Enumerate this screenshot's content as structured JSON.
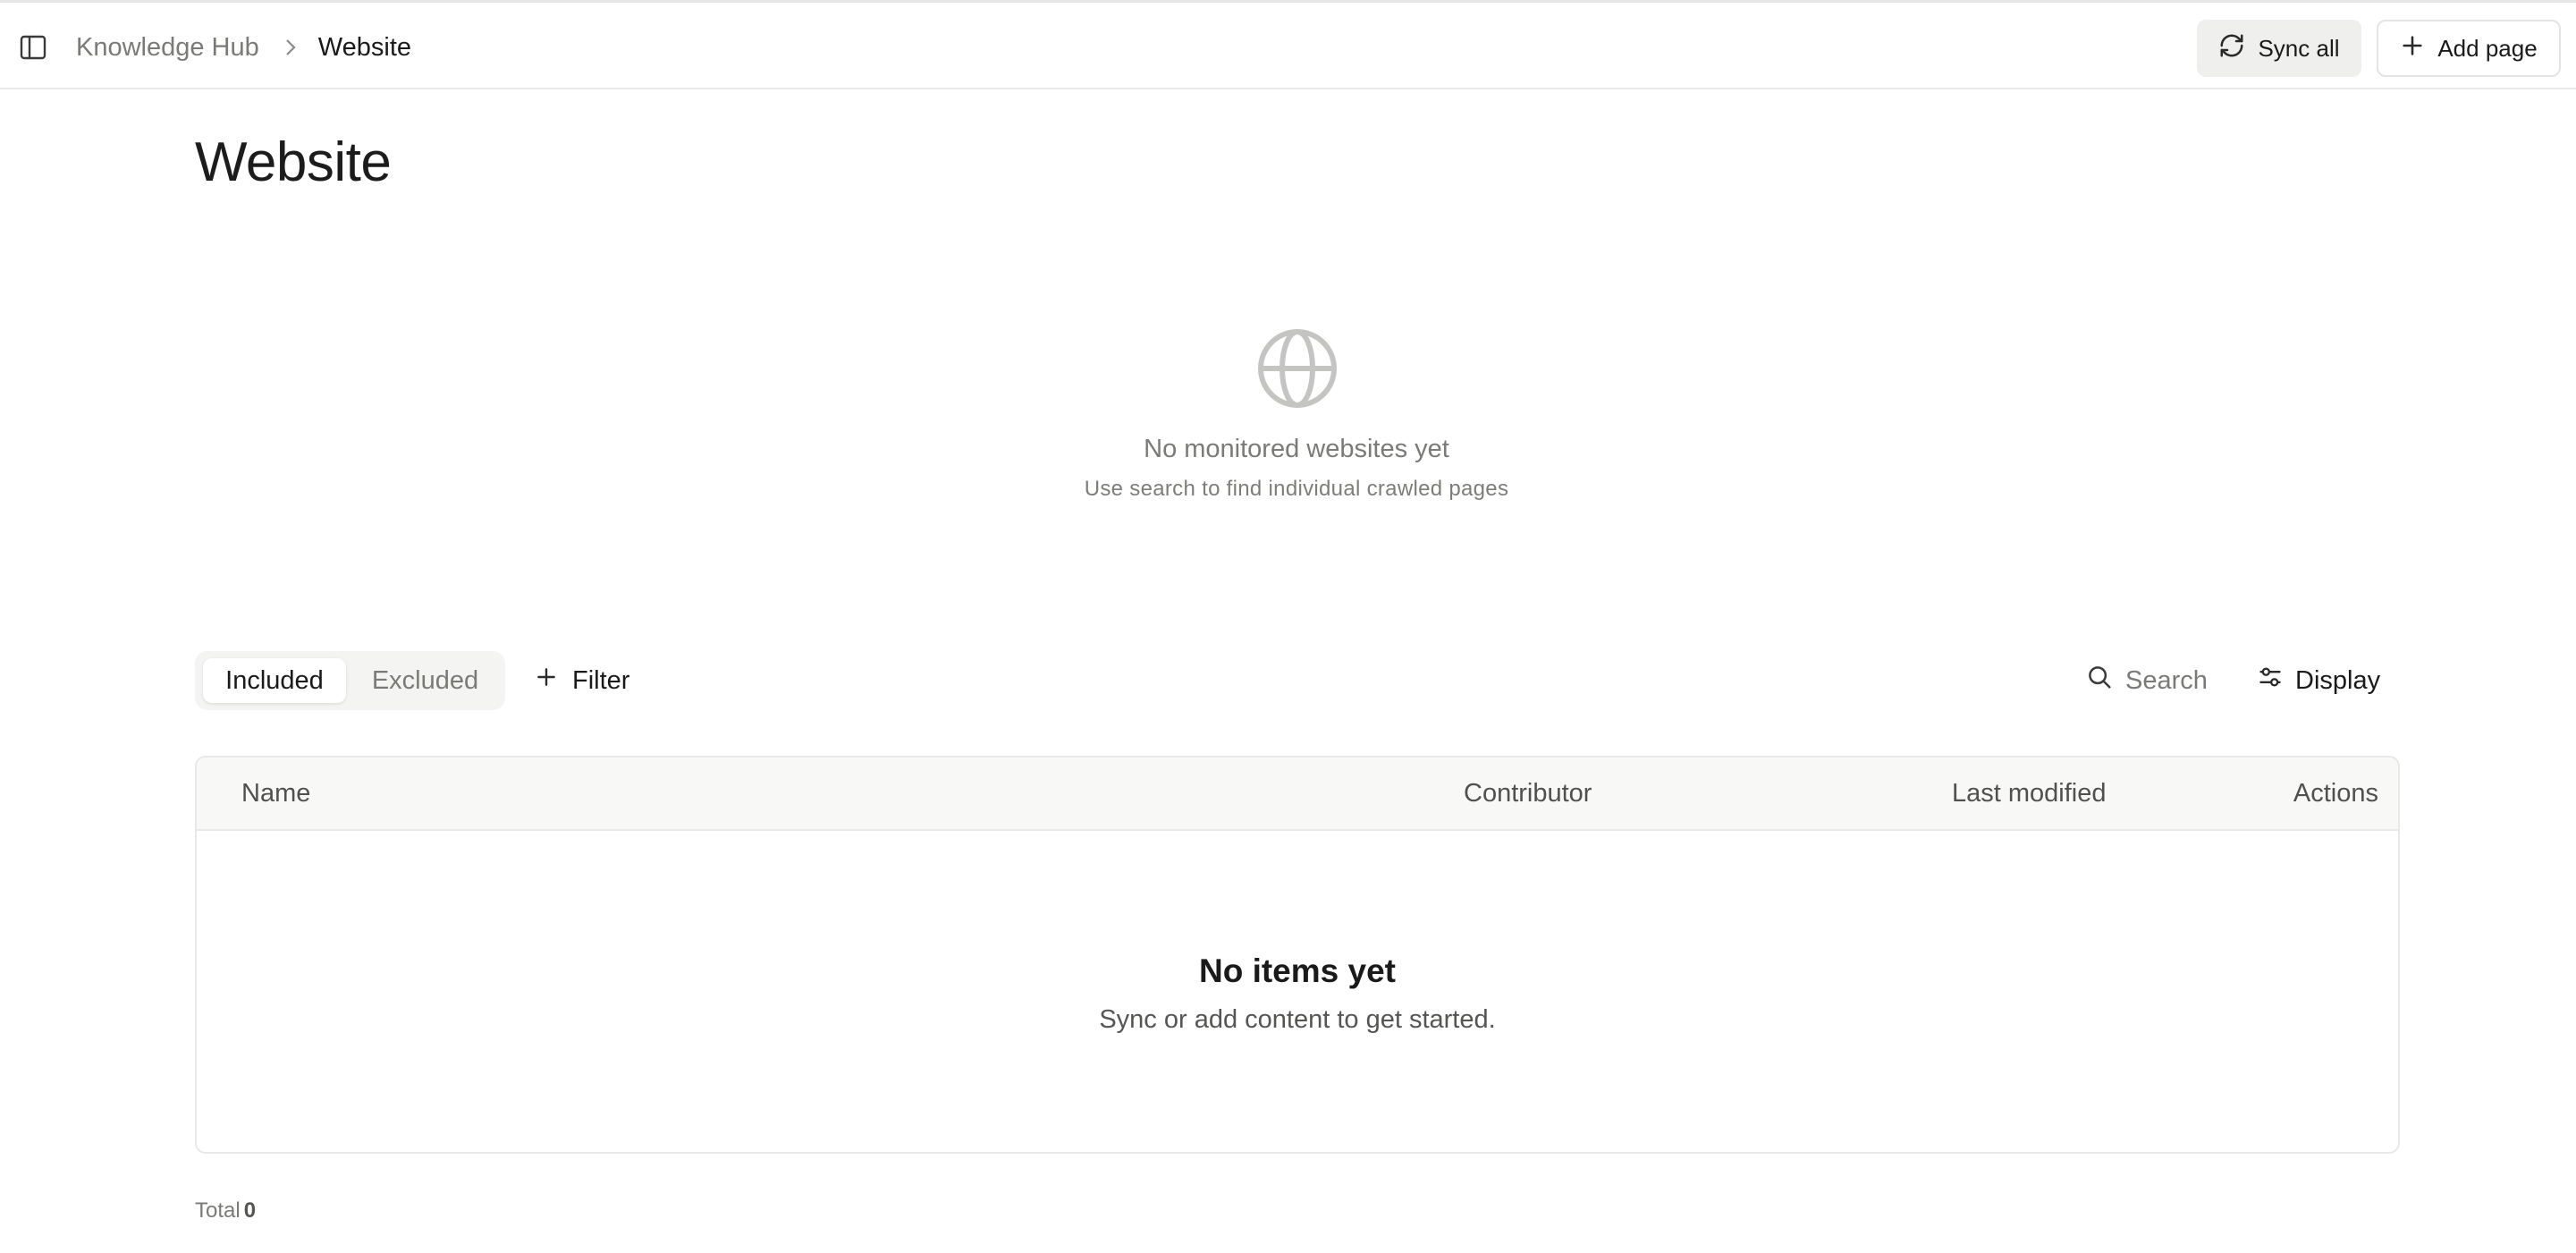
{
  "header": {
    "breadcrumb": {
      "parent": "Knowledge Hub",
      "current": "Website"
    },
    "sync_label": "Sync all",
    "add_label": "Add page"
  },
  "page": {
    "title": "Website"
  },
  "empty_websites": {
    "icon": "globe-icon",
    "title": "No monitored websites yet",
    "subtitle": "Use search to find individual crawled pages"
  },
  "toolbar": {
    "tabs": [
      {
        "label": "Included",
        "active": true
      },
      {
        "label": "Excluded",
        "active": false
      }
    ],
    "filter_label": "Filter",
    "search_label": "Search",
    "display_label": "Display"
  },
  "table": {
    "columns": [
      "Name",
      "Contributor",
      "Last modified",
      "Actions"
    ],
    "empty_title": "No items yet",
    "empty_subtitle": "Sync or add content to get started."
  },
  "footer": {
    "total_label": "Total",
    "total_count": "0"
  },
  "colors": {
    "muted_text": "#7a7a77",
    "border": "#e8e8e6",
    "header_bg": "#f8f8f6",
    "icon_gray": "#c4c4c2"
  }
}
